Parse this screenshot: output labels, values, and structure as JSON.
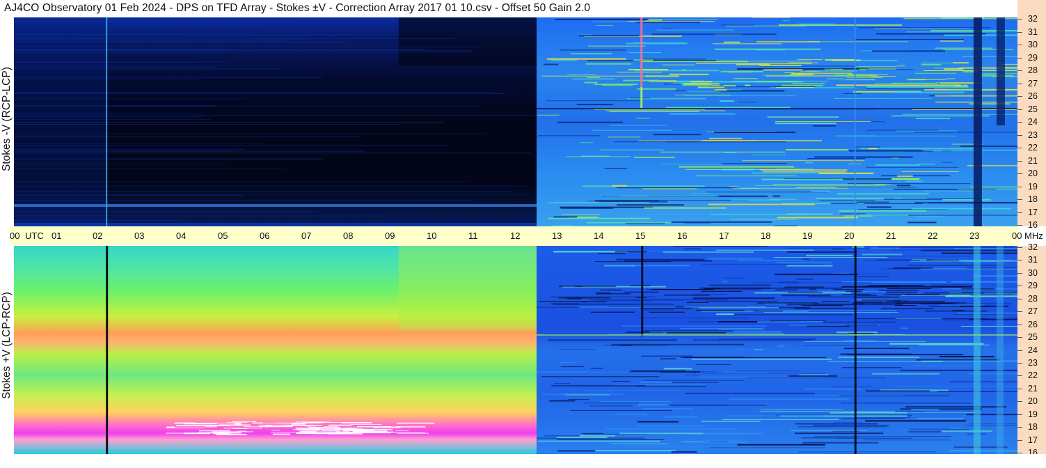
{
  "title": "AJ4CO Observatory  01 Feb 2024  -  DPS on TFD Array  -  Stokes ±V  -  Correction Array 2017 01 10.csv  -  Offset 50  Gain 2.0",
  "chart_data": [
    {
      "type": "heatmap",
      "name": "stokes-minus-v",
      "ylabel": "Stokes -V (RCP-LCP)",
      "x_ticks": [
        "00",
        "UTC",
        "01",
        "02",
        "03",
        "04",
        "05",
        "06",
        "07",
        "08",
        "09",
        "10",
        "11",
        "12",
        "13",
        "14",
        "15",
        "16",
        "17",
        "18",
        "19",
        "20",
        "21",
        "22",
        "23",
        "00",
        "MHz"
      ],
      "x_range_hours": [
        0,
        24
      ],
      "y_ticks": [
        "32",
        "31",
        "30",
        "29",
        "28",
        "27",
        "26",
        "25",
        "24",
        "23",
        "22",
        "21",
        "20",
        "19",
        "18",
        "17",
        "16"
      ],
      "y_range_mhz": [
        16,
        32
      ],
      "palette": "rainbow (dark blue low to white high)",
      "features": {
        "dark_period_hours": [
          2.2,
          12.5
        ],
        "vertical_lines_hours": [
          2.2,
          15.0,
          20.1
        ],
        "bright_band_hours": [
          12.5,
          24.0
        ]
      }
    },
    {
      "type": "heatmap",
      "name": "stokes-plus-v",
      "ylabel": "Stokes +V (LCP-RCP)",
      "y_ticks": [
        "32",
        "31",
        "30",
        "29",
        "28",
        "27",
        "26",
        "25",
        "24",
        "23",
        "22",
        "21",
        "20",
        "19",
        "18",
        "17",
        "16"
      ],
      "y_range_mhz": [
        16,
        32
      ],
      "palette": "rainbow (dark blue low to white high)",
      "features": {
        "warm_period_hours": [
          0,
          12.5
        ],
        "hot_bands_mhz": [
          25,
          18
        ],
        "vertical_lines_hours": [
          2.2,
          15.0,
          20.1
        ]
      }
    }
  ],
  "colors": {
    "axis_bg": "#ffffcc",
    "freq_axis_bg": "#fcdcc0",
    "dark_navy": "#020a2e",
    "mid_blue": "#1a64ff",
    "cyan": "#22c8e6",
    "green_yellow": "#b8f040",
    "orange": "#ff9e50",
    "magenta": "#f040f0"
  }
}
